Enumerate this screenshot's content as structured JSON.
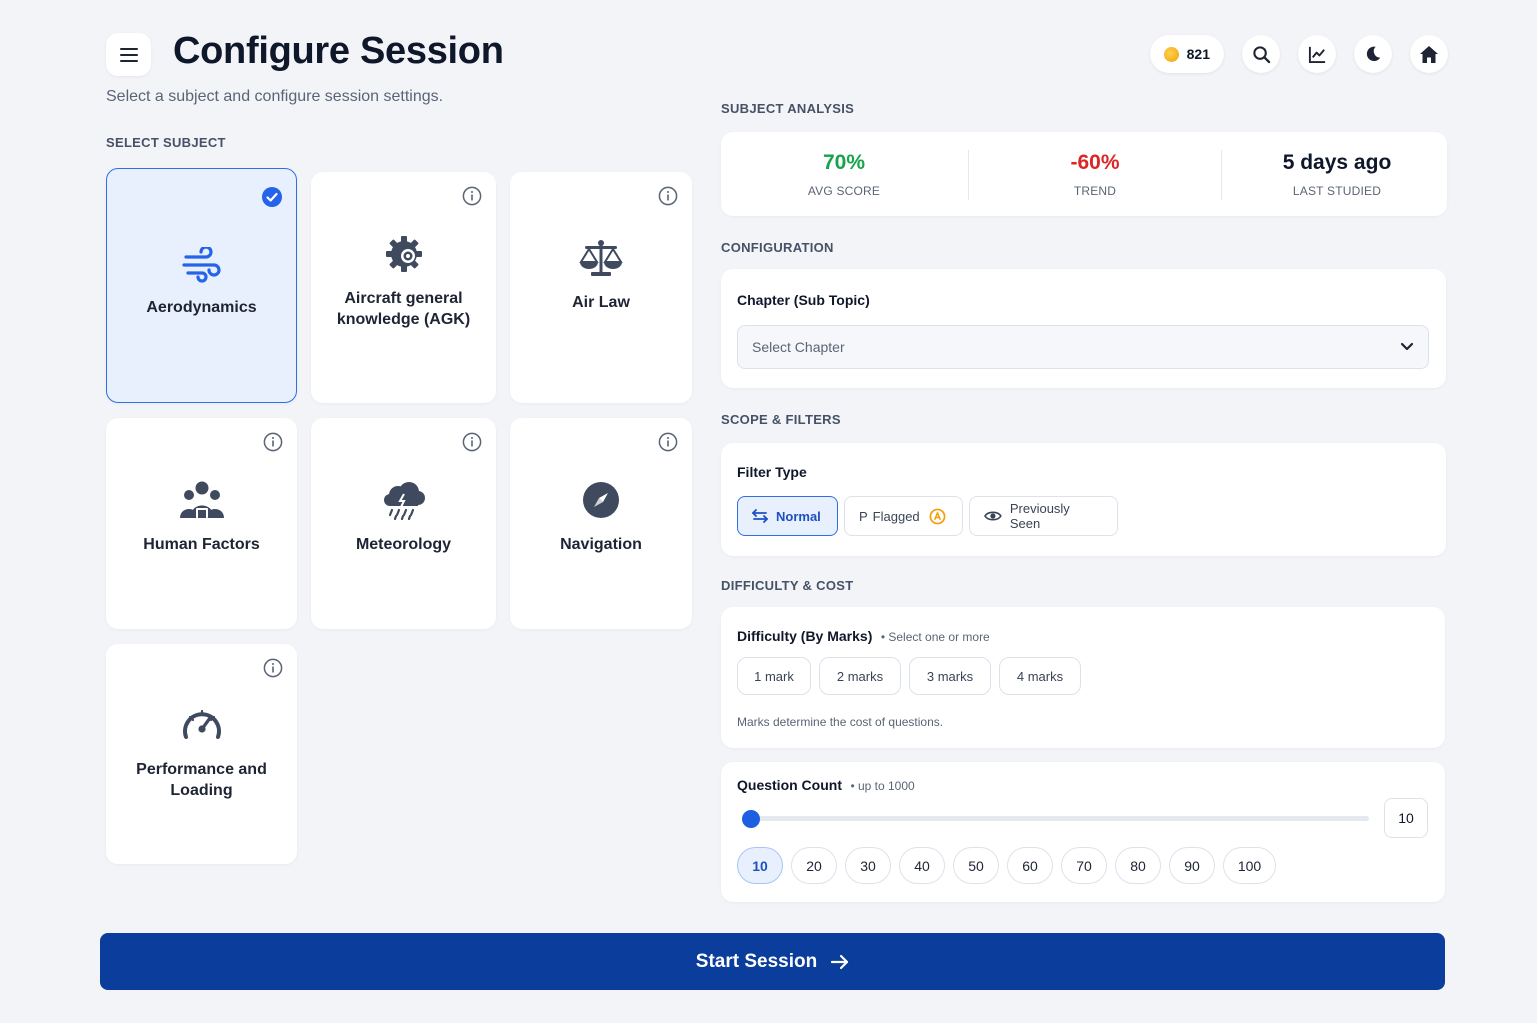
{
  "header": {
    "title": "Configure Session",
    "subtitle": "Select a subject and configure session settings.",
    "coins": "821"
  },
  "subjects_section": {
    "label": "SELECT SUBJECT",
    "items": [
      {
        "label": "Aerodynamics",
        "icon": "wind-icon",
        "selected": true
      },
      {
        "label": "Aircraft general knowledge (AGK)",
        "icon": "gear-icon",
        "selected": false
      },
      {
        "label": "Air Law",
        "icon": "scales-icon",
        "selected": false
      },
      {
        "label": "Human Factors",
        "icon": "people-icon",
        "selected": false
      },
      {
        "label": "Meteorology",
        "icon": "storm-cloud-icon",
        "selected": false
      },
      {
        "label": "Navigation",
        "icon": "compass-icon",
        "selected": false
      },
      {
        "label": "Performance and Loading",
        "icon": "gauge-icon",
        "selected": false
      }
    ]
  },
  "analysis": {
    "label": "SUBJECT ANALYSIS",
    "stats": [
      {
        "value": "70%",
        "label": "AVG SCORE",
        "color": "#16a34a"
      },
      {
        "value": "-60%",
        "label": "TREND",
        "color": "#dc2626"
      },
      {
        "value": "5 days ago",
        "label": "LAST STUDIED",
        "color": "#0f172a"
      }
    ]
  },
  "configuration": {
    "label": "CONFIGURATION",
    "chapter_label": "Chapter (Sub Topic)",
    "chapter_placeholder": "Select Chapter"
  },
  "scope": {
    "label": "SCOPE & FILTERS",
    "filter_label": "Filter Type",
    "filters": [
      {
        "label": "Normal",
        "active": true
      },
      {
        "label": "Flagged",
        "prefix": "P",
        "active": false
      },
      {
        "label": "Previously Seen",
        "active": false
      }
    ]
  },
  "difficulty": {
    "label": "DIFFICULTY & COST",
    "title": "Difficulty (By Marks)",
    "hint": "• Select one or more",
    "marks": [
      "1 mark",
      "2 marks",
      "3 marks",
      "4 marks"
    ],
    "note": "Marks determine the cost of questions."
  },
  "question_count": {
    "title": "Question Count",
    "hint": "• up to 1000",
    "value": "10",
    "max": 1000,
    "presets": [
      "10",
      "20",
      "30",
      "40",
      "50",
      "60",
      "70",
      "80",
      "90",
      "100"
    ],
    "active_preset": "10"
  },
  "start_button": {
    "label": "Start Session"
  },
  "colors": {
    "accent": "#2f6fe4",
    "primary_button": "#0a3d9c",
    "coin": "#f0a20b",
    "flag_badge": "#f59e0b"
  }
}
